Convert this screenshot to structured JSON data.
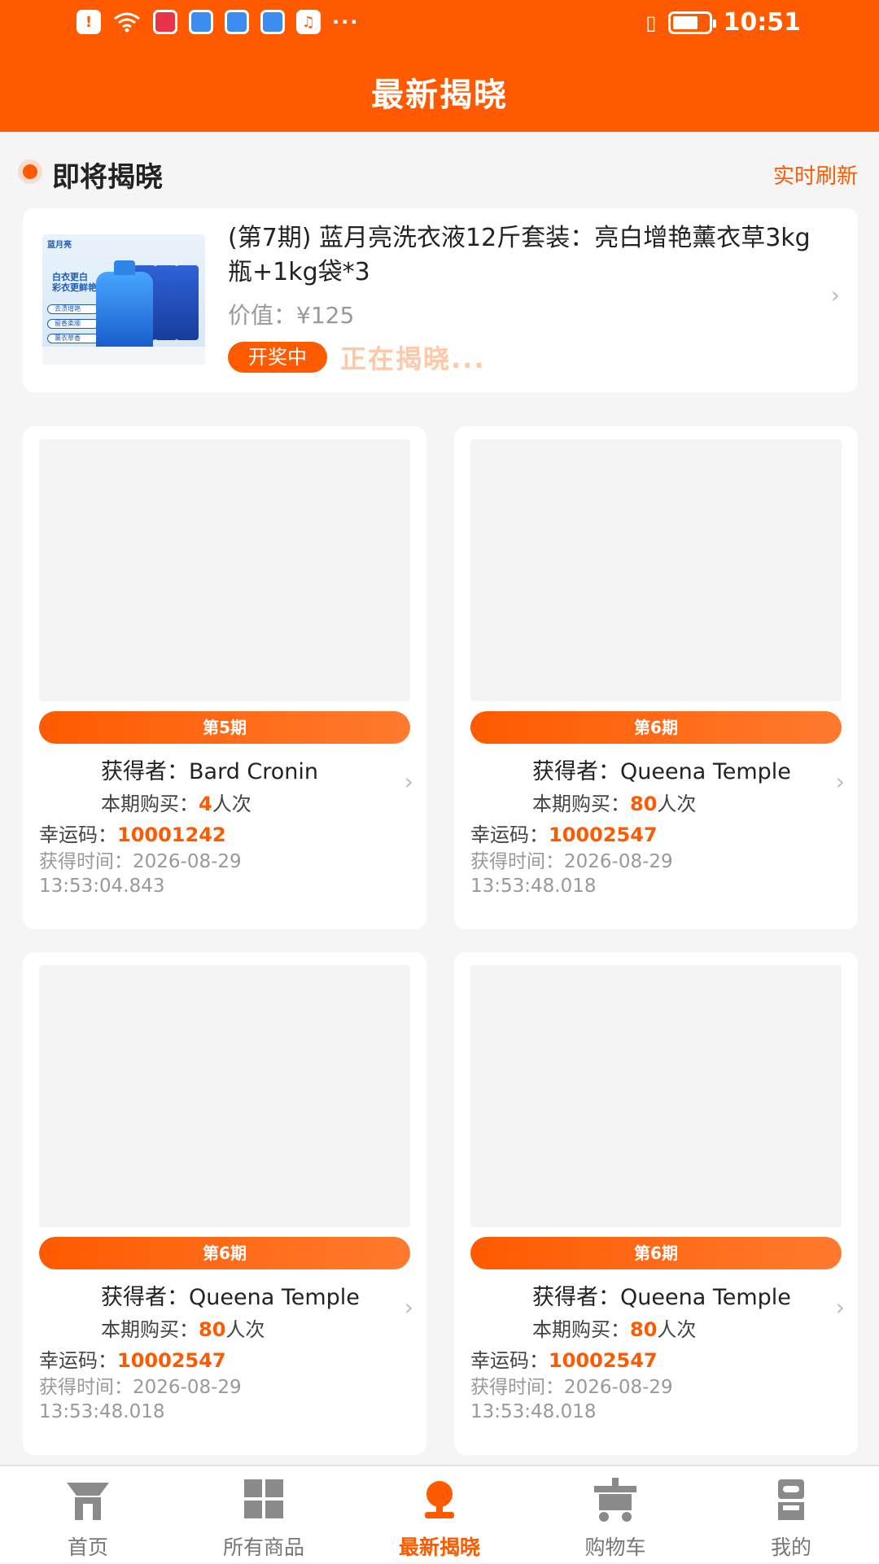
{
  "status_bar": {
    "time": "10:51",
    "left_icons": [
      "notification-alert-icon",
      "wifi-icon",
      "game-app-icon",
      "chat-app-icon",
      "book-app-icon",
      "browser-app-icon",
      "music-app-icon",
      "more-dots-icon"
    ],
    "right_icons": [
      "vibrate-icon",
      "battery-icon"
    ],
    "more": "···"
  },
  "header": {
    "title": "最新揭晓"
  },
  "section": {
    "title": "即将揭晓",
    "refresh_label": "实时刷新"
  },
  "upcoming": {
    "title": "(第7期) 蓝月亮洗衣液12斤套装：亮白增艳薰衣草3kg瓶+1kg袋*3",
    "value": "价值：¥125",
    "badge": "开奖中",
    "status": "正在揭晓...",
    "image_texts": {
      "brand": "蓝月亮",
      "slogan_line1": "白衣更白",
      "slogan_line2": "彩衣更鲜艳",
      "pill1": "去渍增艳",
      "pill2": "留香柔顺",
      "pill3": "薰衣草香"
    }
  },
  "winners": [
    {
      "period": "第5期",
      "winner_label": "获得者：",
      "winner": "Bard Cronin",
      "buy_label": "本期购买：",
      "buy_count": "4",
      "buy_unit": "人次",
      "lucky_label": "幸运码：",
      "lucky_code": "10001242",
      "time_label": "获得时间：",
      "time": "2026-08-29 13:53:04.843"
    },
    {
      "period": "第6期",
      "winner_label": "获得者：",
      "winner": "Queena Temple",
      "buy_label": "本期购买：",
      "buy_count": "80",
      "buy_unit": "人次",
      "lucky_label": "幸运码：",
      "lucky_code": "10002547",
      "time_label": "获得时间：",
      "time": "2026-08-29 13:53:48.018"
    },
    {
      "period": "第6期",
      "winner_label": "获得者：",
      "winner": "Queena Temple",
      "buy_label": "本期购买：",
      "buy_count": "80",
      "buy_unit": "人次",
      "lucky_label": "幸运码：",
      "lucky_code": "10002547",
      "time_label": "获得时间：",
      "time": "2026-08-29 13:53:48.018"
    },
    {
      "period": "第6期",
      "winner_label": "获得者：",
      "winner": "Queena Temple",
      "buy_label": "本期购买：",
      "buy_count": "80",
      "buy_unit": "人次",
      "lucky_label": "幸运码：",
      "lucky_code": "10002547",
      "time_label": "获得时间：",
      "time": "2026-08-29 13:53:48.018"
    }
  ],
  "tabbar": {
    "active_index": 2,
    "items": [
      {
        "label": "首页",
        "icon": "home-icon"
      },
      {
        "label": "所有商品",
        "icon": "grid-icon"
      },
      {
        "label": "最新揭晓",
        "icon": "reveal-icon"
      },
      {
        "label": "购物车",
        "icon": "cart-icon"
      },
      {
        "label": "我的",
        "icon": "profile-icon"
      }
    ]
  },
  "colors": {
    "brand": "#ff5a00",
    "background": "#f5f5f5",
    "status_soft": "#ffc8a6"
  }
}
